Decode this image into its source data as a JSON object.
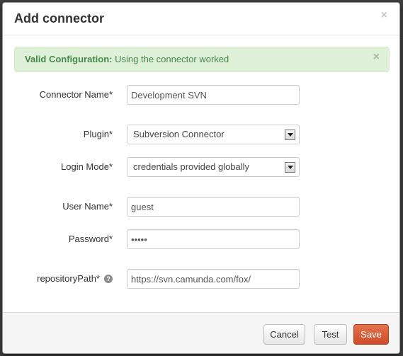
{
  "modal": {
    "title": "Add connector",
    "close_glyph": "×"
  },
  "alert": {
    "strong": "Valid Configuration:",
    "message": "Using the connector worked",
    "close_glyph": "×",
    "color": "#468847",
    "background": "#dff0d8"
  },
  "form": {
    "connector_name": {
      "label": "Connector Name*",
      "value": "Development SVN"
    },
    "plugin": {
      "label": "Plugin*",
      "value": "Subversion Connector"
    },
    "login_mode": {
      "label": "Login Mode*",
      "value": "credentials provided globally"
    },
    "user_name": {
      "label": "User Name*",
      "value": "guest"
    },
    "password": {
      "label": "Password*",
      "value": "•••••"
    },
    "repository_path": {
      "label": "repositoryPath*",
      "value": "https://svn.camunda.com/fox/",
      "help_icon": "question-circle-icon",
      "help_glyph": "?"
    }
  },
  "footer": {
    "cancel_label": "Cancel",
    "test_label": "Test",
    "save_label": "Save",
    "save_color": "#d9542f"
  }
}
